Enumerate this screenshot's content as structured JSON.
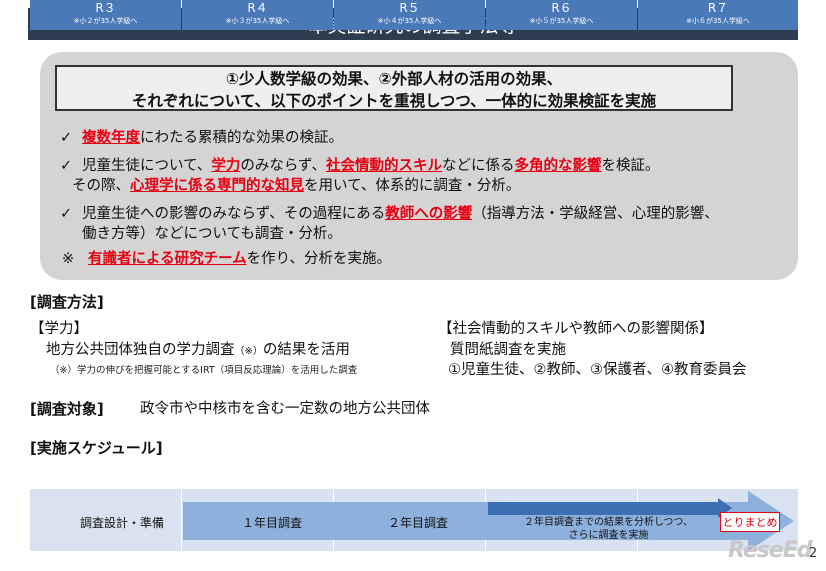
{
  "title": "本実証研究の調査手法等",
  "panel": {
    "header_line1": "①少人数学級の効果、②外部人材の活用の効果、",
    "header_line2": "それぞれについて、以下のポイントを重視しつつ、一体的に効果検証を実施",
    "check": "✓",
    "b1_hl": "複数年度",
    "b1_rest": "にわたる累積的な効果の検証。",
    "b2_pre": "児童生徒について、",
    "b2_hl1": "学力",
    "b2_mid1": "のみならず、",
    "b2_hl2": "社会情動的スキル",
    "b2_mid2": "などに係る",
    "b2_hl3": "多角的な影響",
    "b2_end": "を検証。",
    "b2b_pre": "その際、",
    "b2b_hl": "心理学に係る専門的な知見",
    "b2b_end": "を用いて、体系的に調査・分析。",
    "b3_pre": "児童生徒への影響のみならず、その過程にある",
    "b3_hl": "教師への影響",
    "b3_end": "（指導方法・学級経営、心理的影響、",
    "b3b": "働き方等）などについても調査・分析。",
    "b4_mark": "※",
    "b4_hl": "有識者による研究チーム",
    "b4_end": "を作り、分析を実施。"
  },
  "method": {
    "heading": "[調査方法]",
    "left_label": "【学力】",
    "left_text": "地方公共団体独自の学力調査",
    "left_mark": "（※）",
    "left_text2": "の結果を活用",
    "left_note": "（※）学力の伸びを把握可能とするIRT（項目反応理論）を活用した調査",
    "right_label": "【社会情動的スキルや教師への影響関係】",
    "right_text": "質問紙調査を実施",
    "right_text2": "①児童生徒、②教師、③保護者、④教育委員会"
  },
  "target": {
    "heading": "[調査対象]",
    "text": "政令市や中核市を含む一定数の地方公共団体"
  },
  "schedule": {
    "heading": "[実施スケジュール]",
    "years": [
      {
        "label": "R３",
        "sub": "※小２が35人学級へ"
      },
      {
        "label": "R４",
        "sub": "※小３が35人学級へ"
      },
      {
        "label": "R５",
        "sub": "※小４が35人学級へ"
      },
      {
        "label": "R６",
        "sub": "※小５が35人学級へ"
      },
      {
        "label": "R７",
        "sub": "※小６が35人学級へ"
      }
    ],
    "r3_text": "調査設計・準備",
    "r4_text": "１年目調査",
    "r5_text": "２年目調査",
    "r6_text1": "２年目調査までの結果を分析しつつ、",
    "r6_text2": "さらに調査を実施",
    "final": "とりまとめ"
  },
  "logo": "ReseEd",
  "page_number": "2"
}
